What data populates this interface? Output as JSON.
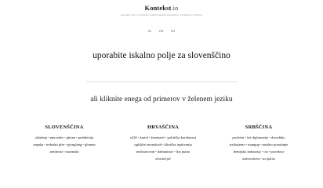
{
  "logo": {
    "name": "Kontekst",
    "tld": ".io"
  },
  "tagline": "zanesljivi izvirni in obiskani vodiščni iskalnik slovenščine, hrvaščine in srbščine",
  "languages": [
    "SL",
    "HR",
    "SR"
  ],
  "prompt": "uporabite iskalno polje za slovenščino",
  "subprompt": "ali kliknite enega od primerov v želenem jeziku",
  "separator": "•",
  "columns": {
    "sl": {
      "title": "SLOVENŠČINA",
      "lines": [
        [
          "skladnja",
          "mercedes",
          "gluten",
          "prehibicija"
        ],
        [
          "napaka",
          "trebušni ples",
          "pjonglang",
          "glonam"
        ],
        [
          "armbrust",
          "marinada"
        ]
      ]
    },
    "hr": {
      "title": "HRVAŠČINA",
      "lines": [
        [
          "a320",
          "kartel",
          "ženskarić",
          "politička korektnost"
        ],
        [
          "uglijični monoksid",
          "klinička ispitivanja"
        ],
        [
          "neobrazovan",
          "dalmatinac",
          "fiat punto"
        ],
        [
          "zlostavljač"
        ]
      ]
    },
    "sr": {
      "title": "SRBŠČINA",
      "lines": [
        [
          "prolećni",
          "šef diplomatije",
          "drvodeljo"
        ],
        [
          "rizikujemo",
          "mangup",
          "nasilno ponašanje"
        ],
        [
          "hemijska industrija",
          "cia",
          "prorektor"
        ],
        [
          "univerziteta",
          "socijalist"
        ]
      ]
    }
  }
}
